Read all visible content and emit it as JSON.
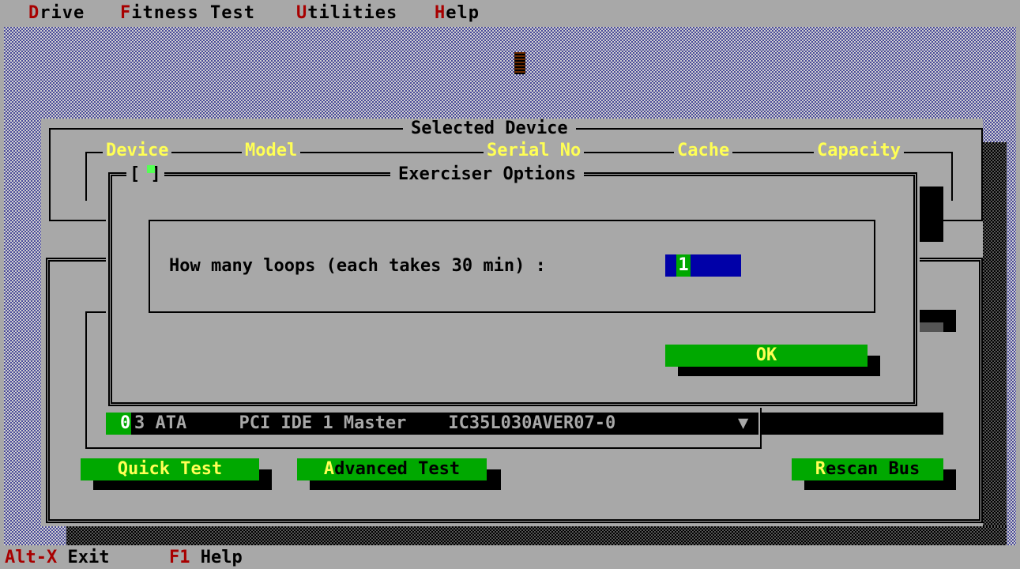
{
  "menubar": {
    "items": [
      {
        "hot": "D",
        "rest": "rive"
      },
      {
        "hot": "F",
        "rest": "itness Test"
      },
      {
        "hot": "U",
        "rest": "tilities"
      },
      {
        "hot": "H",
        "rest": "elp"
      }
    ]
  },
  "status": {
    "exit_key": "Alt-X",
    "exit_label": " Exit",
    "help_key": "F1",
    "help_label": " Help"
  },
  "selected_device": {
    "title": "Selected Device",
    "columns": [
      "Device",
      "Model",
      "Serial No",
      "Cache",
      "Capacity"
    ]
  },
  "drive_list": {
    "selected_first_char": "0",
    "selected_rest": "3 ATA     PCI IDE 1 Master    IC35L030AVER07-0",
    "dropdown_glyph": "▼"
  },
  "buttons": {
    "quick_hot": "Q",
    "quick_rest": "uick Test",
    "advanced_hot": "A",
    "advanced_rest": "dvanced Test",
    "rescan_hot": "R",
    "rescan_rest": "escan Bus"
  },
  "dialog": {
    "title": "Exerciser Options",
    "close_glyph": "[ ]",
    "prompt": "How many loops (each takes 30 min) :",
    "loops_value": "1",
    "ok_label": "OK"
  },
  "colors": {
    "background": "#a8a8a8",
    "hotkey": "#a80000",
    "header_text": "#ffff55",
    "button": "#00a800",
    "input_bg": "#0000a8"
  }
}
